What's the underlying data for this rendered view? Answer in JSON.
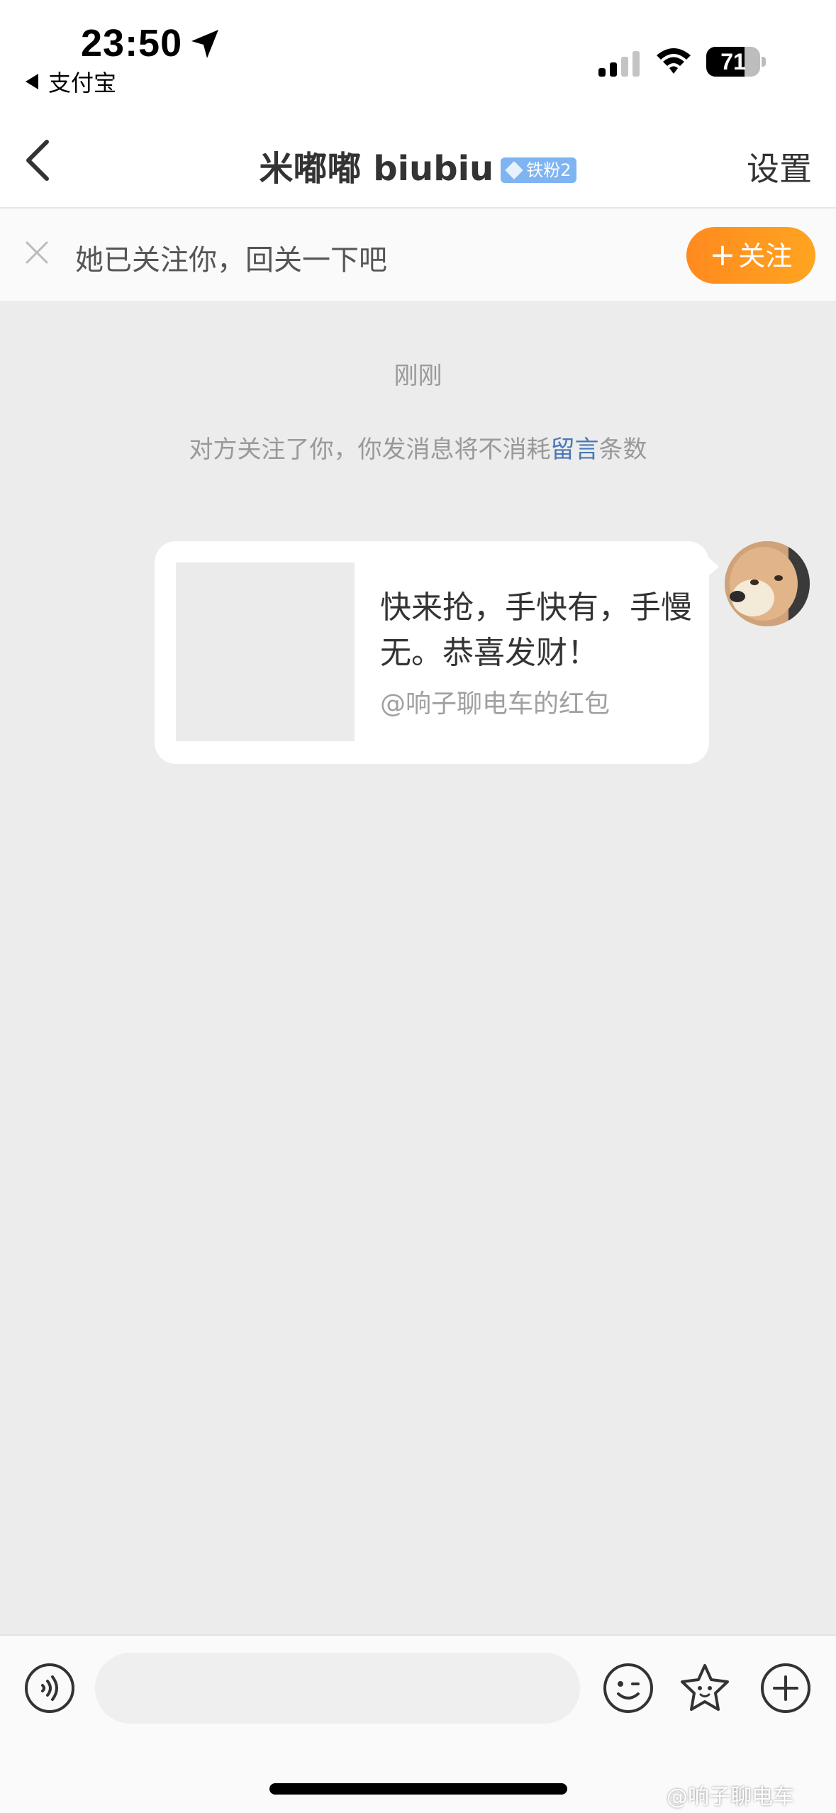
{
  "status_bar": {
    "time": "23:50",
    "back_app": "支付宝",
    "battery": "71",
    "battery_fraction": 0.71
  },
  "nav": {
    "title": "米嘟嘟 biubiu",
    "badge": "铁粉2",
    "settings": "设置"
  },
  "banner": {
    "text": "她已关注你，回关一下吧",
    "follow_button": "关注"
  },
  "chat": {
    "timestamp": "刚刚",
    "notice_prefix": "对方关注了你，你发消息将不消耗",
    "notice_link": "留言",
    "notice_suffix": "条数",
    "message": {
      "text": "快来抢，手快有，手慢无。恭喜发财！",
      "source": "@响子聊电车的红包"
    }
  },
  "watermark": "@响子聊电车",
  "colors": {
    "accent_orange": "#ff8a1f",
    "link_blue": "#4a78b6",
    "badge_blue": "#7fb4f2"
  }
}
